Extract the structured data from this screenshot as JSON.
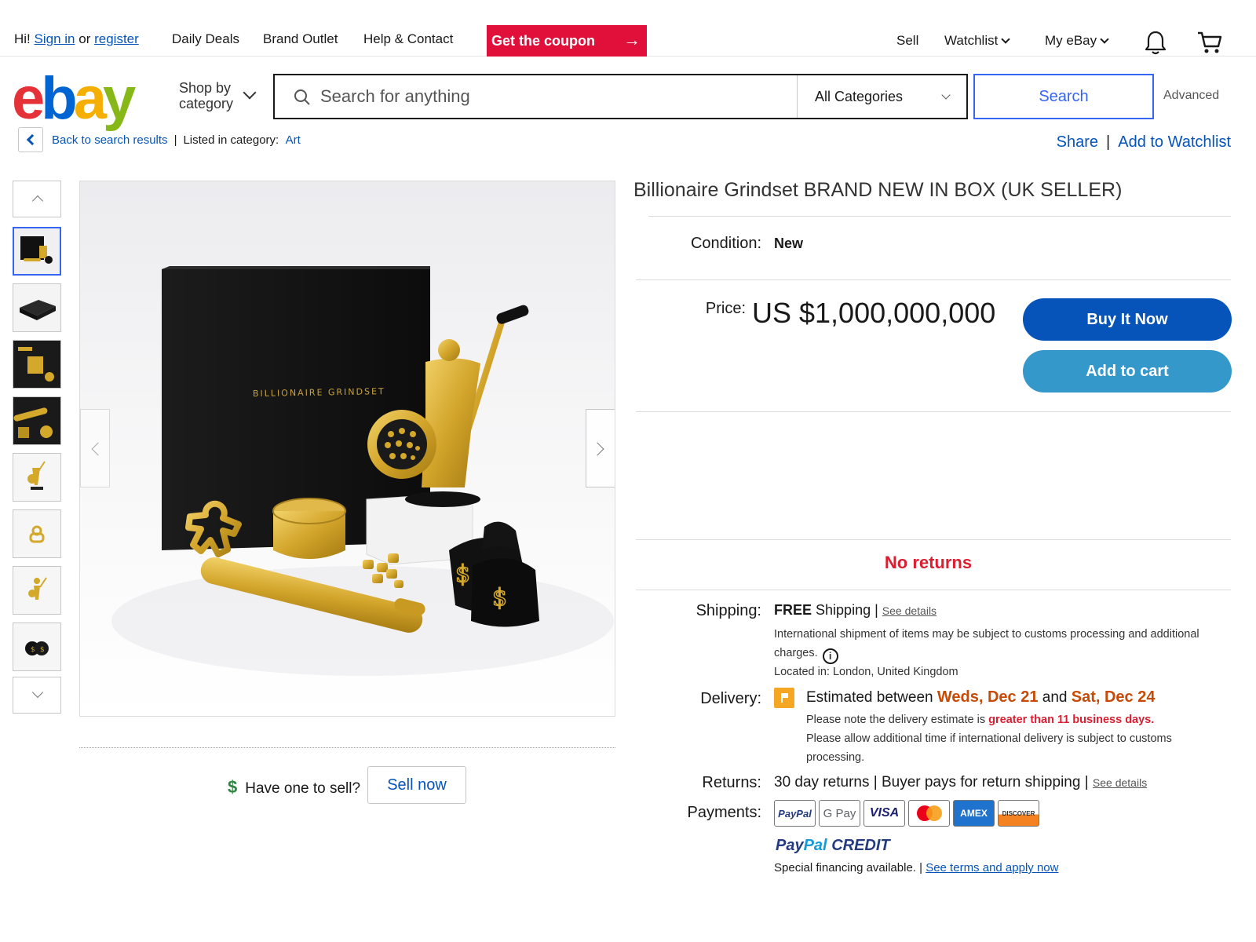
{
  "topbar": {
    "greeting_hi": "Hi!",
    "sign_in": "Sign in",
    "or": "or",
    "register": "register",
    "links": [
      "Daily Deals",
      "Brand Outlet",
      "Help & Contact"
    ],
    "coupon": "Get the coupon",
    "sell": "Sell",
    "watchlist": "Watchlist",
    "my_ebay": "My eBay"
  },
  "header": {
    "logo_letters": [
      "e",
      "b",
      "a",
      "y"
    ],
    "shop_by_category": "Shop by category",
    "search_placeholder": "Search for anything",
    "category_selected": "All Categories",
    "search_button": "Search",
    "advanced": "Advanced"
  },
  "breadcrumb": {
    "back": "Back to search results",
    "listed_in": "Listed in category:",
    "category": "Art",
    "share": "Share",
    "add_to_watchlist": "Add to Watchlist"
  },
  "gallery": {
    "box_text": "BILLIONAIRE GRINDSET",
    "thumbnail_count": 8,
    "have_one": "Have one to sell?",
    "sell_now": "Sell now"
  },
  "listing": {
    "title": "Billionaire Grindset BRAND NEW IN BOX (UK SELLER)",
    "condition_label": "Condition:",
    "condition_value": "New",
    "price_label": "Price:",
    "price": "US $1,000,000,000",
    "buy_it_now": "Buy It Now",
    "add_to_cart": "Add to cart",
    "no_returns": "No returns",
    "shipping_label": "Shipping:",
    "shipping_free": "FREE",
    "shipping_text": "Shipping |",
    "see_details": "See details",
    "intl_note_1": "International shipment of items may be subject to customs processing and additional",
    "intl_note_2": "charges.",
    "located_in": "Located in: London, United Kingdom",
    "delivery_label": "Delivery:",
    "delivery_est": "Estimated between",
    "delivery_from": "Weds, Dec 21",
    "delivery_and": "and",
    "delivery_to": "Sat, Dec 24",
    "delivery_note_pre": "Please note the delivery estimate is",
    "delivery_note_hl": "greater than 11 business days.",
    "delivery_note_2": "Please allow additional time if international delivery is subject to customs",
    "delivery_note_3": "processing.",
    "returns_label": "Returns:",
    "returns_text": "30 day returns | Buyer pays for return shipping |",
    "returns_see_details": "See details",
    "payments_label": "Payments:",
    "payment_methods": [
      "PayPal",
      "G Pay",
      "VISA",
      "Mastercard",
      "AMEX",
      "DISCOVER"
    ],
    "paypal_credit": [
      "Pay",
      "Pal",
      "CREDIT"
    ],
    "financing": "Special financing available. |",
    "financing_link": "See terms and apply now"
  },
  "colors": {
    "link_blue": "#0654ba",
    "buy_blue": "#0654ba",
    "cart_blue": "#3498ca",
    "coupon_red": "#e0103a",
    "no_returns_red": "#dd1e31",
    "delivery_orange": "#c74b06"
  }
}
